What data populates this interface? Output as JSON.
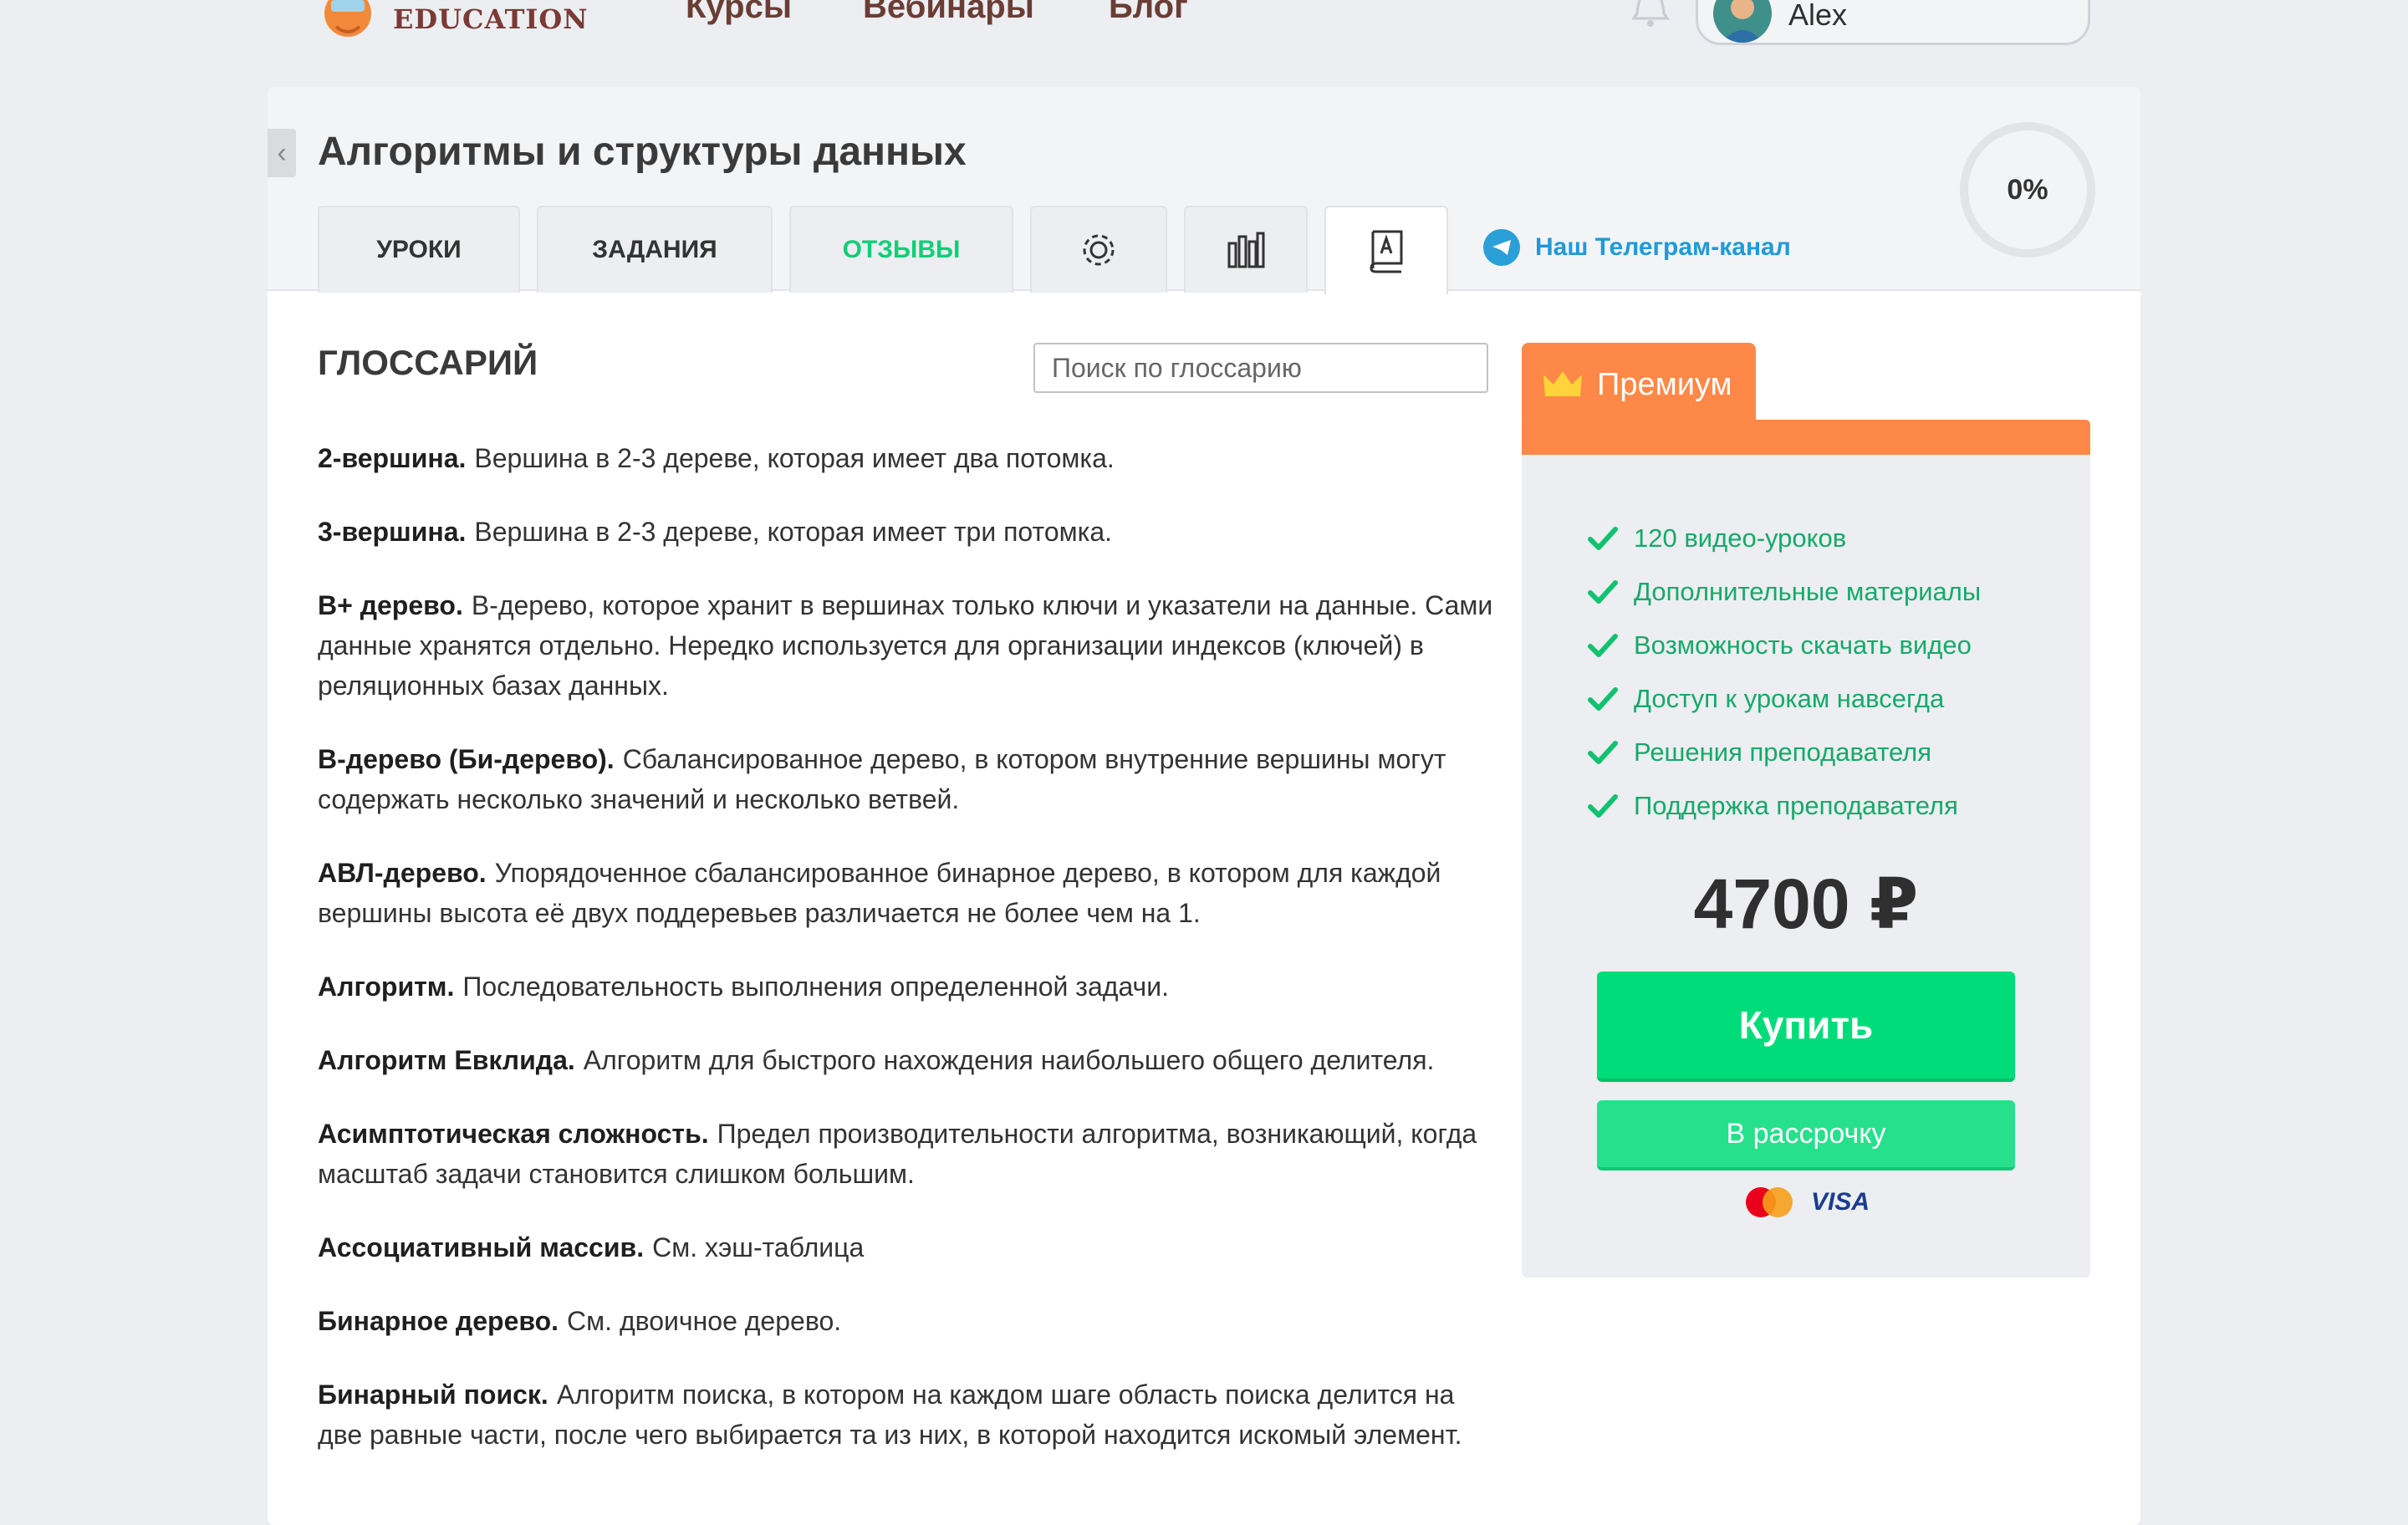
{
  "header": {
    "logo_text": "EDUCATION",
    "nav": [
      "Курсы",
      "Вебинары",
      "Блог"
    ],
    "user_name": "Alex"
  },
  "course": {
    "title": "Алгоритмы и структуры данных",
    "tabs": [
      "УРОКИ",
      "ЗАДАНИЯ",
      "ОТЗЫВЫ"
    ],
    "telegram_label": "Наш Телеграм-канал",
    "progress": "0%",
    "back_glyph": "‹"
  },
  "glossary": {
    "title": "ГЛОССАРИЙ",
    "search_placeholder": "Поиск по глоссарию",
    "entries": [
      {
        "term": "2-вершина.",
        "def": "Вершина в 2-3 дереве, которая имеет два потомка."
      },
      {
        "term": "3-вершина.",
        "def": "Вершина в 2-3 дереве, которая имеет три потомка."
      },
      {
        "term": "B+ дерево.",
        "def": "B-дерево, которое хранит в вершинах только ключи и указатели на данные. Сами данные хранятся отдельно. Нередко используется для организации индексов (ключей) в реляционных базах данных."
      },
      {
        "term": "B-дерево (Би-дерево).",
        "def": "Сбалансированное дерево, в котором внутренние вершины могут содержать несколько значений и несколько ветвей."
      },
      {
        "term": "АВЛ-дерево.",
        "def": "Упорядоченное сбалансированное бинарное дерево, в котором для каждой вершины высота её двух поддеревьев различается не более чем на 1."
      },
      {
        "term": "Алгоритм.",
        "def": "Последовательность выполнения определенной задачи."
      },
      {
        "term": "Алгоритм Евклида.",
        "def": "Алгоритм для быстрого нахождения наибольшего общего делителя."
      },
      {
        "term": "Асимптотическая сложность.",
        "def": "Предел производительности алгоритма, возникающий, когда масштаб задачи становится слишком большим."
      },
      {
        "term": "Ассоциативный массив.",
        "def": "См. хэш-таблица"
      },
      {
        "term": "Бинарное дерево.",
        "def": "См. двоичное дерево."
      },
      {
        "term": "Бинарный поиск.",
        "def": "Алгоритм поиска, в котором на каждом шаге область поиска делится на две равные части, после чего выбирается та из них, в которой находится искомый элемент."
      }
    ]
  },
  "premium": {
    "label": "Премиум",
    "features": [
      "120 видео-уроков",
      "Дополнительные материалы",
      "Возможность скачать видео",
      "Доступ к урокам навсегда",
      "Решения преподавателя",
      "Поддержка преподавателя"
    ],
    "price": "4700 ₽",
    "buy_label": "Купить",
    "installment_label": "В рассрочку",
    "payment_visa": "VISA"
  },
  "colors": {
    "accent_green": "#00dc79",
    "premium_orange": "#fe8847",
    "telegram_blue": "#1f9ad9"
  }
}
